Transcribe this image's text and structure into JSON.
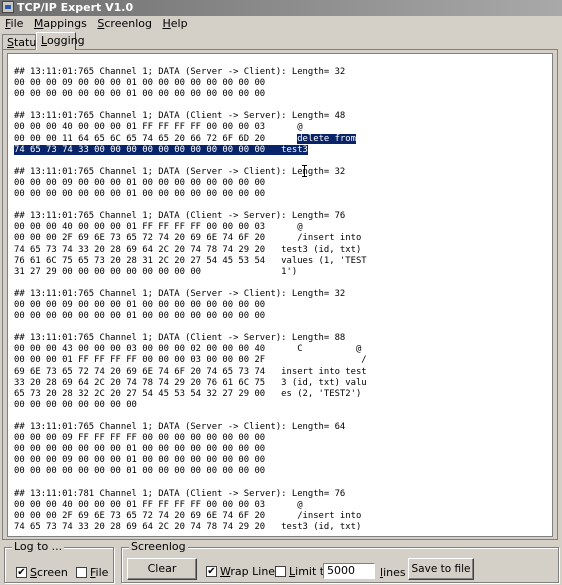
{
  "window": {
    "title": "TCP/IP Expert V1.0"
  },
  "menu": [
    "File",
    "Mappings",
    "Screenlog",
    "Help"
  ],
  "tabs": [
    {
      "label": "Status",
      "active": false
    },
    {
      "label": "Logging",
      "active": true
    }
  ],
  "log": [
    {
      "lines": [
        "## 13:11:01:765 Channel 1; DATA (Server -> Client): Length= 32",
        "00 00 00 09 00 00 00 01 00 00 00 00 00 00 00 00",
        "00 00 00 00 00 00 00 01 00 00 00 00 00 00 00 00"
      ]
    },
    {
      "lines": [
        "## 13:11:01:765 Channel 1; DATA (Client -> Server): Length= 48",
        "00 00 00 40 00 00 00 01 FF FF FF FF 00 00 00 03      @"
      ],
      "selected_a": [
        "00 00 00 11 64 65 6C 65 74 65 20 66 72 6F 6D 20      ",
        "delete from"
      ],
      "selected_b": "74 65 73 74 33 00 00 00 00 00 00 00 00 00 00 00   test3"
    },
    {
      "lines": [
        "## 13:11:01:765 Channel 1; DATA (Server -> Client): Length= 32",
        "00 00 00 09 00 00 00 01 00 00 00 00 00 00 00 00",
        "00 00 00 00 00 00 00 01 00 00 00 00 00 00 00 00"
      ]
    },
    {
      "lines": [
        "## 13:11:01:765 Channel 1; DATA (Client -> Server): Length= 76",
        "00 00 00 40 00 00 00 01 FF FF FF FF 00 00 00 03      @",
        "00 00 00 2F 69 6E 73 65 72 74 20 69 6E 74 6F 20      /insert into",
        "74 65 73 74 33 20 28 69 64 2C 20 74 78 74 29 20   test3 (id, txt)",
        "76 61 6C 75 65 73 20 28 31 2C 20 27 54 45 53 54   values (1, 'TEST",
        "31 27 29 00 00 00 00 00 00 00 00 00               1')"
      ]
    },
    {
      "lines": [
        "## 13:11:01:765 Channel 1; DATA (Server -> Client): Length= 32",
        "00 00 00 09 00 00 00 01 00 00 00 00 00 00 00 00",
        "00 00 00 00 00 00 00 01 00 00 00 00 00 00 00 00"
      ]
    },
    {
      "lines": [
        "## 13:11:01:765 Channel 1; DATA (Client -> Server): Length= 88",
        "00 00 00 43 00 00 00 03 00 00 00 02 00 00 00 40      C          @",
        "00 00 00 01 FF FF FF FF 00 00 00 03 00 00 00 2F                  /",
        "69 6E 73 65 72 74 20 69 6E 74 6F 20 74 65 73 74   insert into test",
        "33 20 28 69 64 2C 20 74 78 74 29 20 76 61 6C 75   3 (id, txt) valu",
        "65 73 20 28 32 2C 20 27 54 45 53 54 32 27 29 00   es (2, 'TEST2')",
        "00 00 00 00 00 00 00 00"
      ]
    },
    {
      "lines": [
        "## 13:11:01:765 Channel 1; DATA (Server -> Client): Length= 64",
        "00 00 00 09 FF FF FF FF 00 00 00 00 00 00 00 00",
        "00 00 00 00 00 00 00 01 00 00 00 00 00 00 00 00",
        "00 00 00 09 00 00 00 01 00 00 00 00 00 00 00 00",
        "00 00 00 00 00 00 00 01 00 00 00 00 00 00 00 00"
      ]
    },
    {
      "lines": [
        "## 13:11:01:781 Channel 1; DATA (Client -> Server): Length= 76",
        "00 00 00 40 00 00 00 01 FF FF FF FF 00 00 00 03      @",
        "00 00 00 2F 69 6E 73 65 72 74 20 69 6E 74 6F 20      /insert into",
        "74 65 73 74 33 20 28 69 64 2C 20 74 78 74 29 20   test3 (id, txt)"
      ]
    }
  ],
  "log_to": {
    "legend": "Log to ...",
    "screen_label": "Screen",
    "screen_checked": true,
    "file_label": "File",
    "file_checked": false
  },
  "screenlog": {
    "legend": "Screenlog",
    "clear_label": "Clear",
    "wrap_label": "Wrap Lines",
    "wrap_checked": true,
    "limit_label": "Limit to",
    "limit_checked": false,
    "limit_value": "5000",
    "lines_label": "lines",
    "save_label": "Save to file"
  }
}
